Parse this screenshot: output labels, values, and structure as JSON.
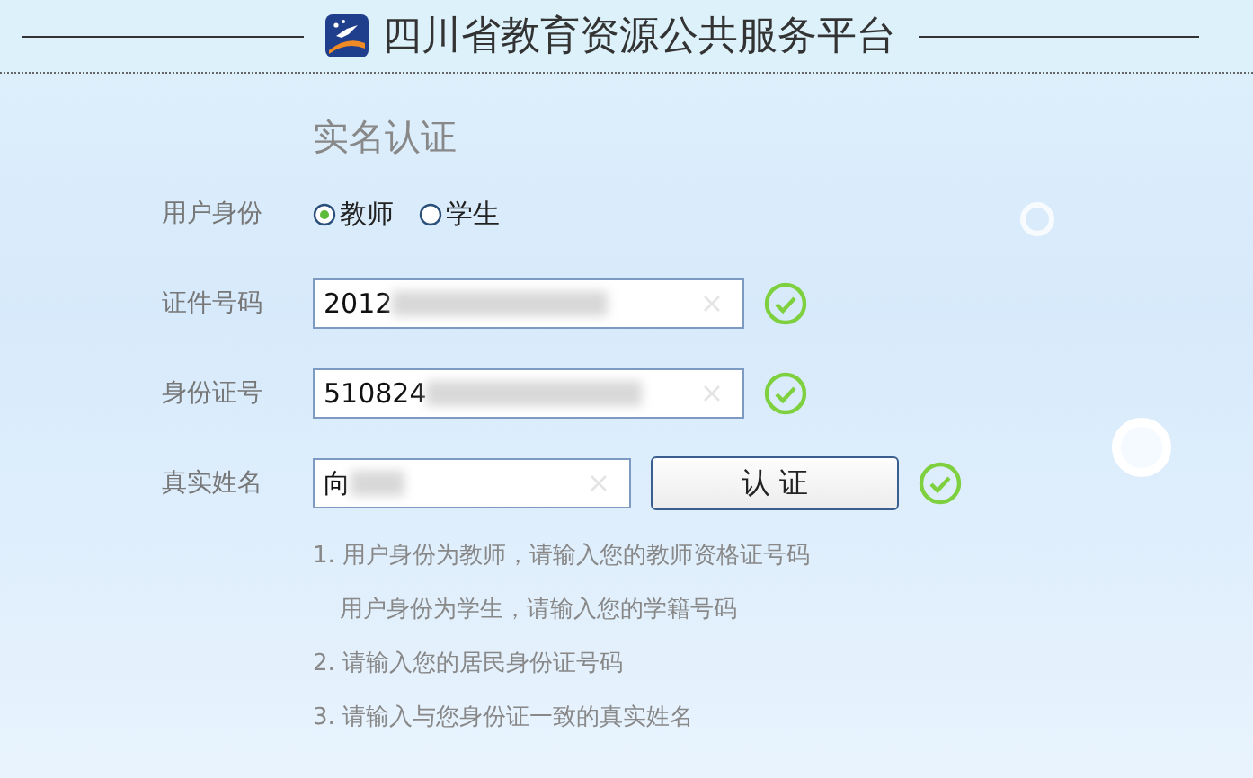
{
  "header": {
    "title": "四川省教育资源公共服务平台"
  },
  "form": {
    "title": "实名认证",
    "identity": {
      "label": "用户身份",
      "options": [
        {
          "label": "教师",
          "selected": true
        },
        {
          "label": "学生",
          "selected": false
        }
      ]
    },
    "fields": [
      {
        "label": "证件号码",
        "value": "2012",
        "valid": true
      },
      {
        "label": "身份证号",
        "value": "510824",
        "valid": true
      },
      {
        "label": "真实姓名",
        "value": "向",
        "valid": true
      }
    ],
    "submit": "认 证",
    "hints": [
      {
        "kind": "numbered",
        "text": "1. 用户身份为教师，请输入您的教师资格证号码"
      },
      {
        "kind": "continued",
        "text": "用户身份为学生，请输入您的学籍号码"
      },
      {
        "kind": "numbered",
        "text": "2. 请输入您的居民身份证号码"
      },
      {
        "kind": "numbered",
        "text": "3. 请输入与您身份证一致的真实姓名"
      }
    ]
  }
}
